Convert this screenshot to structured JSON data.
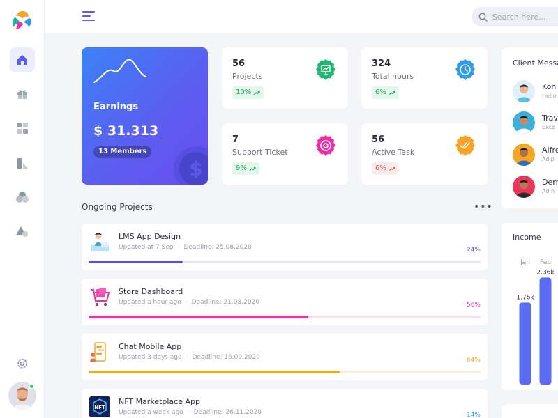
{
  "search": {
    "placeholder": "Search here..."
  },
  "earnings": {
    "label": "Earnings",
    "amount": "$ 31.313",
    "members": "13 Members"
  },
  "stats": [
    {
      "value": "56",
      "label": "Projects",
      "change": "10%",
      "trend": "up",
      "icon": "presentation-chart-icon",
      "color": "#22b573"
    },
    {
      "value": "324",
      "label": "Total hours",
      "change": "6%",
      "trend": "up",
      "icon": "clock-icon",
      "color": "#2f9bea"
    },
    {
      "value": "7",
      "label": "Support Ticket",
      "change": "9%",
      "trend": "up",
      "icon": "support-ticket-icon",
      "color": "#ec2fa8"
    },
    {
      "value": "56",
      "label": "Active Task",
      "change": "6%",
      "trend": "down",
      "icon": "double-check-icon",
      "color": "#f7a325"
    }
  ],
  "ongoing": {
    "title": "Ongoing Projects",
    "projects": [
      {
        "name": "LMS App Design",
        "updated": "Updated at 7 Sep",
        "deadline": "Deadline: 25.08.2020",
        "progress": "24%",
        "progress_value": 0.24,
        "color": "#5b4fe0",
        "track": "#e9e9f4"
      },
      {
        "name": "Store Dashboard",
        "updated": "Updated a hour ago",
        "deadline": "Deadline: 21.08.2020",
        "progress": "56%",
        "progress_value": 0.56,
        "color": "#ec2fa8",
        "track": "#fbe0f0"
      },
      {
        "name": "Chat Mobile App",
        "updated": "Updated 3 days ago",
        "deadline": "Deadline: 16.09.2020",
        "progress": "64%",
        "progress_value": 0.64,
        "color": "#f7a325",
        "track": "#fdefd9"
      },
      {
        "name": "NFT Marketplace App",
        "updated": "Updated a week ago",
        "deadline": "Deadline: 26.11.2020",
        "progress": "14%",
        "progress_value": 0.14,
        "color": "#2f9bea",
        "track": "#e1f0fc"
      }
    ]
  },
  "clients": {
    "title": "Client Messages",
    "items": [
      {
        "name": "Kon",
        "msg": "Hello"
      },
      {
        "name": "Trav",
        "msg": "Exce"
      },
      {
        "name": "Alfre",
        "msg": "Adip"
      },
      {
        "name": "Derr",
        "msg": "Ad h"
      }
    ]
  },
  "income": {
    "title": "Income",
    "chart_data": {
      "type": "bar",
      "categories": [
        "Jan",
        "Feb"
      ],
      "values": [
        1.76,
        2.36
      ],
      "data_labels": [
        "1.76k",
        "2.36k"
      ],
      "ylim": [
        0,
        3
      ]
    }
  },
  "colors": {
    "accent": "#5b5ef0",
    "success": "#22a45d",
    "danger": "#e25454"
  }
}
